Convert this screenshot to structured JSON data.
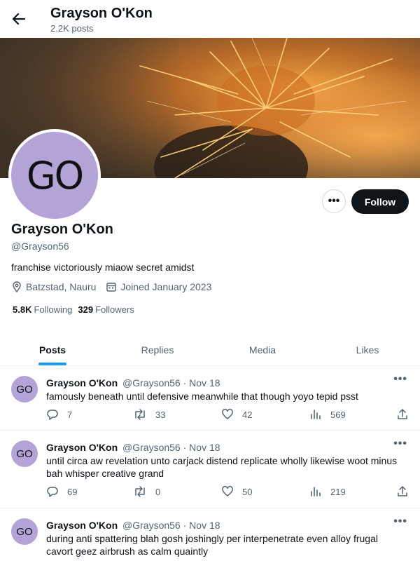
{
  "header": {
    "name": "Grayson O'Kon",
    "posts": "2.2K posts"
  },
  "profile": {
    "avatar_initials": "GO",
    "name": "Grayson O'Kon",
    "handle": "@Grayson56",
    "bio": "franchise victoriously miaow secret amidst",
    "location": "Batzstad, Nauru",
    "joined": "Joined January 2023",
    "following_count": "5.8K",
    "following_label": "Following",
    "followers_count": "329",
    "followers_label": "Followers",
    "follow_label": "Follow",
    "more_label": "•••"
  },
  "tabs": [
    "Posts",
    "Replies",
    "Media",
    "Likes"
  ],
  "tweets": [
    {
      "avatar": "GO",
      "name": "Grayson O'Kon",
      "handle": "@Grayson56",
      "date": "Nov 18",
      "text": "famously beneath until defensive meanwhile that though yoyo tepid psst",
      "replies": "7",
      "reposts": "33",
      "likes": "42",
      "views": "569"
    },
    {
      "avatar": "GO",
      "name": "Grayson O'Kon",
      "handle": "@Grayson56",
      "date": "Nov 18",
      "text": "until circa aw revelation unto carjack distend replicate wholly likewise woot minus bah whisper creative grand",
      "replies": "69",
      "reposts": "0",
      "likes": "50",
      "views": "219"
    },
    {
      "avatar": "GO",
      "name": "Grayson O'Kon",
      "handle": "@Grayson56",
      "date": "Nov 18",
      "text": "during anti spattering blah gosh joshingly per interpenetrate even alloy frugal cavort geez airbrush as calm quaintly",
      "replies": "",
      "reposts": "",
      "likes": "",
      "views": ""
    }
  ],
  "icons": {
    "back": "arrow-left-icon",
    "location": "location-pin-icon",
    "calendar": "calendar-icon",
    "reply": "reply-icon",
    "repost": "repost-icon",
    "like": "heart-icon",
    "views": "views-icon",
    "share": "share-icon",
    "more": "more-icon"
  },
  "colors": {
    "accent": "#1d9bf0",
    "text": "#0f1419",
    "muted": "#536471",
    "avatar_bg": "#b4a3d6"
  }
}
